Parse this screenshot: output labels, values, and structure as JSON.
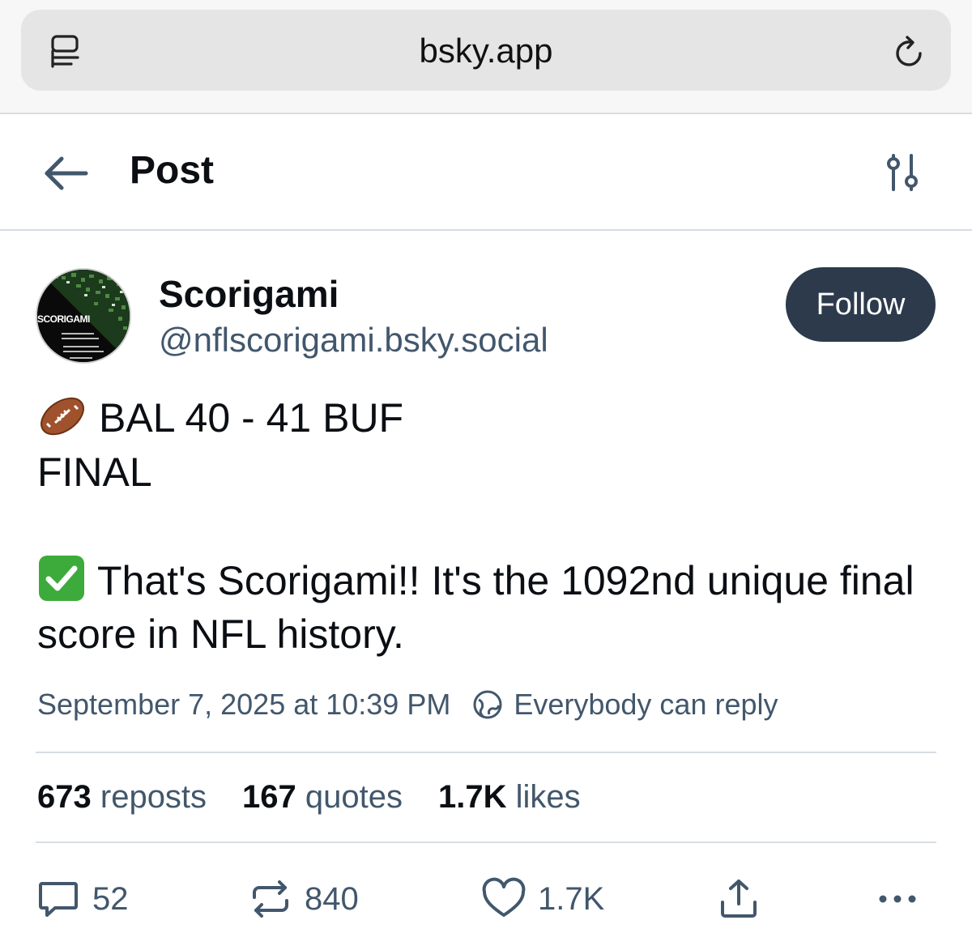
{
  "browser": {
    "url": "bsky.app",
    "icons": {
      "tabs": "tabs-icon",
      "reload": "reload-icon"
    }
  },
  "header": {
    "title": "Post",
    "icons": {
      "back": "arrow-left-icon",
      "settings": "sliders-icon"
    }
  },
  "author": {
    "display_name": "Scorigami",
    "handle": "@nflscorigami.bsky.social",
    "avatar_text": "SCORIGAMI",
    "follow_label": "Follow"
  },
  "post": {
    "line1": "BAL 40 - 41 BUF",
    "line2": "FINAL",
    "line3": "That's Scorigami!! It's the 1092nd unique final score in NFL history.",
    "emoji1": "american-football-emoji",
    "emoji2": "check-mark-emoji",
    "timestamp": "September 7, 2025 at 10:39 PM",
    "reply_setting": "Everybody can reply"
  },
  "stats": {
    "reposts_count": "673",
    "reposts_label": "reposts",
    "quotes_count": "167",
    "quotes_label": "quotes",
    "likes_count": "1.7K",
    "likes_label": "likes"
  },
  "actions": {
    "reply_count": "52",
    "repost_count": "840",
    "like_count": "1.7K"
  },
  "colors": {
    "follow_bg": "#2c3a4b",
    "muted_text": "#42576c",
    "divider": "#d7dde4"
  }
}
